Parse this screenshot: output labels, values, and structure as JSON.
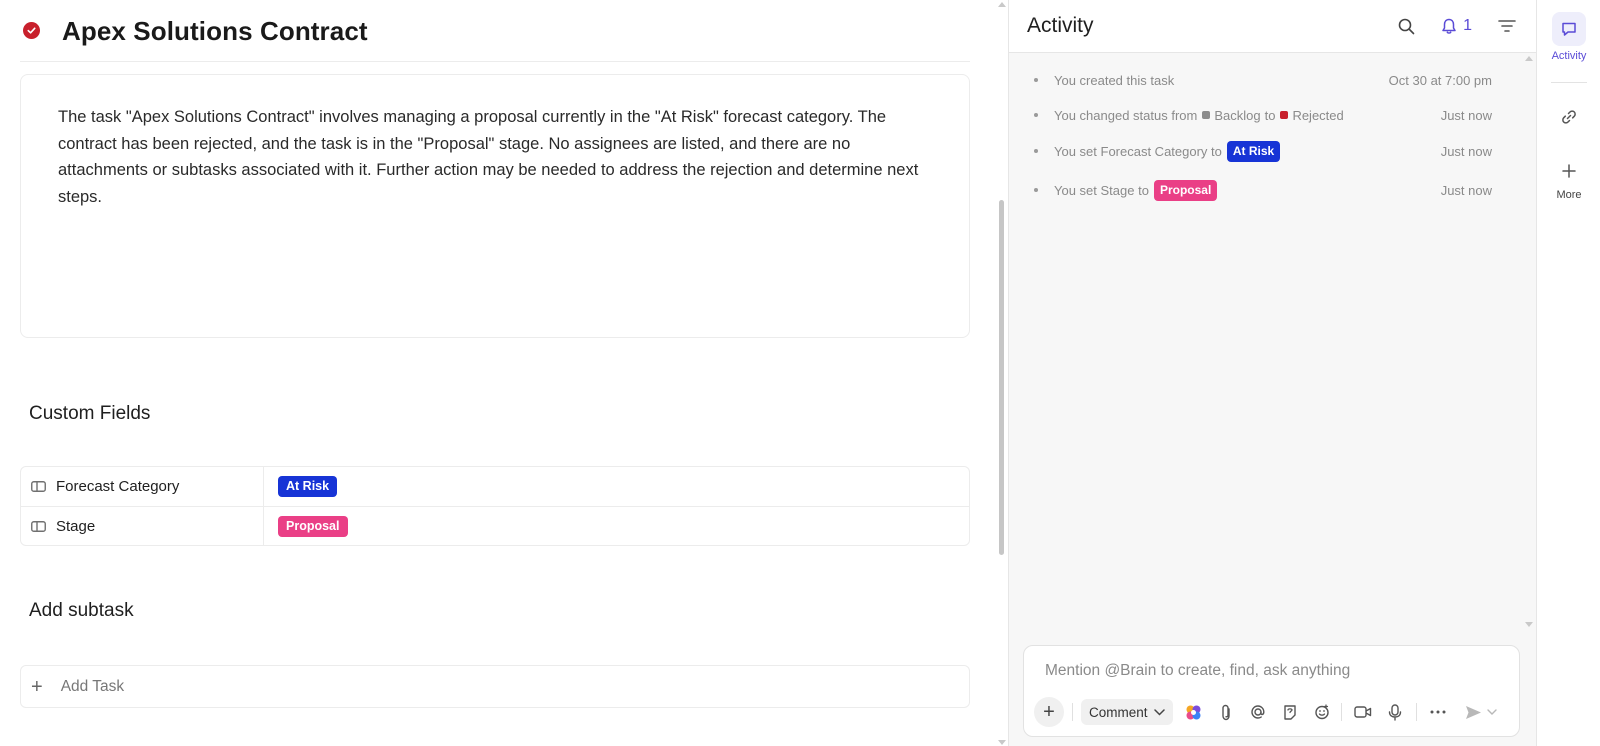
{
  "task": {
    "title": "Apex Solutions Contract",
    "status_icon": "check-circle-icon",
    "status_color": "#c8202c",
    "description": "The task \"Apex Solutions Contract\" involves managing a proposal currently in the \"At Risk\" forecast category. The contract has been rejected, and the task is in the \"Proposal\" stage. No assignees are listed, and there are no attachments or subtasks associated with it. Further action may be needed to address the rejection and determine next steps."
  },
  "custom_fields": {
    "section_title": "Custom Fields",
    "rows": [
      {
        "label": "Forecast Category",
        "value": "At Risk",
        "color": "#1734d6"
      },
      {
        "label": "Stage",
        "value": "Proposal",
        "color": "#ea3f86"
      }
    ]
  },
  "subtasks": {
    "section_title": "Add subtask",
    "add_label": "Add Task"
  },
  "activity": {
    "title": "Activity",
    "notification_count": "1",
    "items": [
      {
        "text": "You created this task",
        "time": "Oct 30 at 7:00 pm"
      },
      {
        "prefix": "You changed status from",
        "from": "Backlog",
        "from_color": "#8c8c8c",
        "to_word": "to",
        "to": "Rejected",
        "to_color": "#c8202c",
        "time": "Just now"
      },
      {
        "prefix": "You set Forecast Category to",
        "badge": "At Risk",
        "badge_color": "#1734d6",
        "time": "Just now"
      },
      {
        "prefix": "You set Stage to",
        "badge": "Proposal",
        "badge_color": "#ea3f86",
        "time": "Just now"
      }
    ]
  },
  "composer": {
    "placeholder": "Mention @Brain to create, find, ask anything",
    "mode_label": "Comment"
  },
  "rail": {
    "activity_label": "Activity",
    "more_label": "More"
  },
  "colors": {
    "accent": "#5a4bd6",
    "brain": "#7b4ddb"
  }
}
